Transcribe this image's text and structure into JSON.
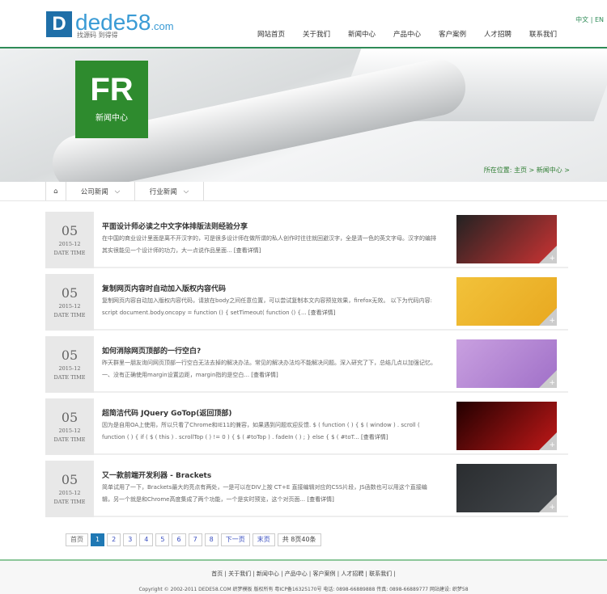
{
  "header": {
    "logo_text": "dede58",
    "logo_suffix": ".com",
    "logo_slogan": "找源码 到得得",
    "lang": "中文 | EN",
    "nav": [
      "网站首页",
      "关于我们",
      "新闻中心",
      "产品中心",
      "客户案例",
      "人才招聘",
      "联系我们"
    ]
  },
  "banner": {
    "badge_logo": "FR",
    "badge_label": "新闻中心",
    "breadcrumb": "所在位置: 主页 > 新闻中心 >"
  },
  "subnav": {
    "tabs": [
      "公司新闻",
      "行业新闻"
    ]
  },
  "articles": [
    {
      "day": "05",
      "ym": "2015-12",
      "dt": "DATE TIME",
      "title": "平面设计师必读之中文字体排版法则经验分享",
      "desc": "在中国的商业设计里面是离不开汉字的，可是很多设计师在做所谓的私人创作时往往就回避汉字，全是清一色的英文字母。汉字的编排其实很能见一个设计师的功力，大一点说作品里面...",
      "more": "[查看详情]",
      "colors": [
        "#222",
        "#c33"
      ]
    },
    {
      "day": "05",
      "ym": "2015-12",
      "dt": "DATE TIME",
      "title": "复制网页内容时自动加入版权内容代码",
      "desc": "复制网页内容自动加入版权内容代码，请放在body之间任意位置，可以尝试复制本文内容预览效果，firefox无效。 以下为代码内容: script document.body.oncopy = function () { setTimeout( function () {...",
      "more": "[查看详情]",
      "colors": [
        "#f2c23a",
        "#e8a820"
      ]
    },
    {
      "day": "05",
      "ym": "2015-12",
      "dt": "DATE TIME",
      "title": "如何消除网页顶部的一行空白?",
      "desc": "昨天群里一朋友询问网页顶部一行空白无法去掉的解决办法。常见的解决办法均不能解决问题。深入研究了下，总结几点以加强记忆。 一、没有正确使用margin设置边距，margin指的是空白...",
      "more": "[查看详情]",
      "colors": [
        "#c9a0e0",
        "#a070c8"
      ]
    },
    {
      "day": "05",
      "ym": "2015-12",
      "dt": "DATE TIME",
      "title": "超简洁代码 JQuery GoTop(返回顶部)",
      "desc": "因为是自用OA上使用，所以只看了Chrome和IE11的兼容，如果遇到问题欢迎反馈. $ ( function ( ) { $ ( window ) . scroll ( function ( ) { if ( $ ( this ) . scrollTop ( ) != 0 ) { $ ( #toTop ) . fadeIn ( ) ; } else { $ ( #toT...",
      "more": "[查看详情]",
      "colors": [
        "#200",
        "#c01818"
      ]
    },
    {
      "day": "05",
      "ym": "2015-12",
      "dt": "DATE TIME",
      "title": "又一款前端开发利器 - Brackets",
      "desc": "简单试用了一下，Brackets最大的亮点有两处，一是可以在DIV上按 CT+E 直接编辑对应的CSS片段，JS函数也可以用这个直接编辑，另一个就是和Chrome高度集成了两个功能，一个是实时预览，这个对页面...",
      "more": "[查看详情]",
      "colors": [
        "#2a2d30",
        "#44484c"
      ]
    }
  ],
  "pager": {
    "first": "首页",
    "pages": [
      "1",
      "2",
      "3",
      "4",
      "5",
      "6",
      "7",
      "8"
    ],
    "next": "下一页",
    "last": "末页",
    "total": "共 8页40条"
  },
  "footer": {
    "links": "首页 | 关于我们 | 新闻中心 | 产品中心 | 客户案例 | 人才招聘 | 联系我们 |",
    "copyright": "Copyright © 2002-2011 DEDE58.COM 织梦模板 版权所有  粤ICP备16325170号  电话: 0898-66889888 传真: 0898-66889777  网站建设: 织梦58"
  }
}
